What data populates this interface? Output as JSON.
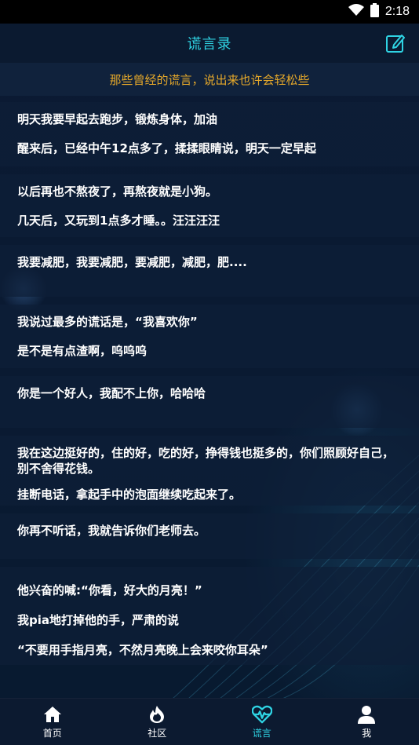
{
  "status_bar": {
    "time": "2:18"
  },
  "app_bar": {
    "title": "谎言录"
  },
  "subtitle": "那些曾经的谎言，说出来也许会轻松些",
  "entries": [
    {
      "lines": [
        "明天我要早起去跑步，锻炼身体，加油",
        "醒来后，已经中午12点多了，揉揉眼睛说，明天一定早起"
      ]
    },
    {
      "lines": [
        "以后再也不熬夜了，再熬夜就是小狗。",
        "几天后，又玩到1点多才睡。。汪汪汪汪"
      ]
    },
    {
      "lines": [
        "我要减肥，我要减肥，要减肥，减肥，肥...."
      ]
    },
    {
      "lines": [
        "我说过最多的谎话是，“我喜欢你”",
        "是不是有点渣啊，呜呜呜"
      ]
    },
    {
      "lines": [
        "你是一个好人，我配不上你，哈哈哈"
      ]
    },
    {
      "lines": [
        "我在这边挺好的，住的好，吃的好，挣得钱也挺多的，你们照顾好自己，别不舍得花钱。",
        "挂断电话，拿起手中的泡面继续吃起来了。"
      ]
    },
    {
      "lines": [
        "你再不听话，我就告诉你们老师去。"
      ]
    },
    {
      "lines": [
        "他兴奋的喊:“你看，好大的月亮！”",
        "我pia地打掉他的手，严肃的说",
        "“不要用手指月亮，不然月亮晚上会来咬你耳朵”"
      ]
    }
  ],
  "bottom_nav": [
    {
      "label": "首页",
      "icon": "home-icon",
      "active": false
    },
    {
      "label": "社区",
      "icon": "flame-icon",
      "active": false
    },
    {
      "label": "谎言",
      "icon": "heartbeat-icon",
      "active": true
    },
    {
      "label": "我",
      "icon": "user-icon",
      "active": false
    }
  ],
  "colors": {
    "accent": "#2fd3e3",
    "subtitle": "#e5a82a",
    "background": "#0b1a33"
  }
}
